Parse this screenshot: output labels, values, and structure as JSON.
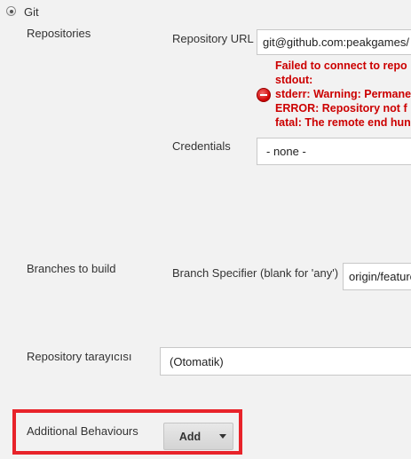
{
  "scm": {
    "option_label": "Git",
    "selected": true
  },
  "repositories": {
    "section_label": "Repositories",
    "url_label": "Repository URL",
    "url_value": "git@github.com:peakgames/",
    "error_lines": [
      "Failed to connect to repo",
      "stdout:",
      "stderr: Warning: Permane",
      "ERROR: Repository not f",
      "fatal: The remote end hun"
    ],
    "credentials_label": "Credentials",
    "credentials_value": "- none -"
  },
  "branches": {
    "section_label": "Branches to build",
    "specifier_label": "Branch Specifier (blank for 'any')",
    "specifier_value": "origin/feature"
  },
  "browser": {
    "label": "Repository tarayıcısı",
    "value": "(Otomatik)"
  },
  "behaviours": {
    "label": "Additional Behaviours",
    "add_button": "Add"
  },
  "colors": {
    "error": "#cc0000",
    "highlight": "#e8232a"
  }
}
